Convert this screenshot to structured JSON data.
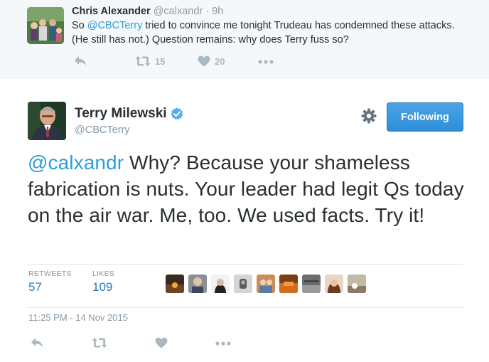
{
  "parent_tweet": {
    "author_name": "Chris Alexander",
    "author_handle": "@calxandr",
    "time_sep": " · ",
    "time_ago": "9h",
    "text_prefix": "So ",
    "mention": "@CBCTerry",
    "text_rest": " tried to convince me tonight Trudeau has condemned these attacks. (He still has not.) Question remains: why does Terry fuss so?",
    "retweet_count": "15",
    "like_count": "20",
    "icons": [
      "reply-icon",
      "retweet-icon",
      "heart-icon",
      "more-icon"
    ]
  },
  "main_tweet": {
    "author_name": "Terry Milewski",
    "author_handle": "@CBCTerry",
    "verified": true,
    "follow_label": "Following",
    "mention": "@calxandr",
    "text_rest": " Why? Because your shameless fabrication is nuts. Your leader had legit Qs today on the air war. Me, too. We used facts. Try it!",
    "stats": {
      "retweets_label": "RETWEETS",
      "retweets_value": "57",
      "likes_label": "LIKES",
      "likes_value": "109"
    },
    "liker_count_shown": 9,
    "timestamp": "11:25 PM - 14 Nov 2015",
    "icons": [
      "reply-icon",
      "retweet-icon",
      "heart-icon",
      "more-icon",
      "gear-icon",
      "verified-badge-icon"
    ]
  },
  "colors": {
    "link": "#2b9fd8",
    "follow_button": "#3b94d9",
    "muted": "#8899a6",
    "action_icon": "#aab8c2",
    "parent_bg": "#f5f8fa"
  }
}
